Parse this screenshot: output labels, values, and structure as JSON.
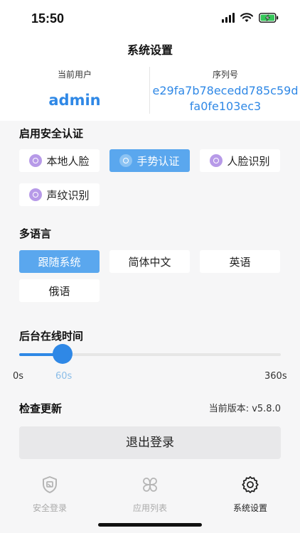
{
  "status_bar": {
    "time": "15:50"
  },
  "nav": {
    "title": "系统设置"
  },
  "user_info": {
    "current_user_label": "当前用户",
    "current_user": "admin",
    "serial_label": "序列号",
    "serial": "e29fa7b78ecedd785c59dfa0fe103ec3"
  },
  "security": {
    "title": "启用安全认证",
    "options": [
      {
        "label": "本地人脸",
        "icon": "face-icon",
        "active": false
      },
      {
        "label": "手势认证",
        "icon": "gesture-icon",
        "active": true
      },
      {
        "label": "人脸识别",
        "icon": "face-recognition-icon",
        "active": false
      },
      {
        "label": "声纹识别",
        "icon": "voiceprint-icon",
        "active": false
      }
    ]
  },
  "language": {
    "title": "多语言",
    "options": [
      {
        "label": "跟随系统",
        "active": true
      },
      {
        "label": "简体中文",
        "active": false
      },
      {
        "label": "英语",
        "active": false
      },
      {
        "label": "俄语",
        "active": false
      }
    ]
  },
  "background_time": {
    "title": "后台在线时间",
    "min_label": "0s",
    "current_label": "60s",
    "max_label": "360s",
    "value": 60,
    "min": 0,
    "max": 360
  },
  "update": {
    "title": "检查更新",
    "version": "当前版本: v5.8.0"
  },
  "logout_label": "退出登录",
  "tabs": [
    {
      "label": "安全登录",
      "icon": "shield-icon",
      "active": false
    },
    {
      "label": "应用列表",
      "icon": "app-grid-icon",
      "active": false
    },
    {
      "label": "系统设置",
      "icon": "gear-icon",
      "active": true
    }
  ],
  "colors": {
    "accent": "#2f88e6",
    "chip_active": "#5aa7ee",
    "icon_purple": "#b79ae8"
  }
}
